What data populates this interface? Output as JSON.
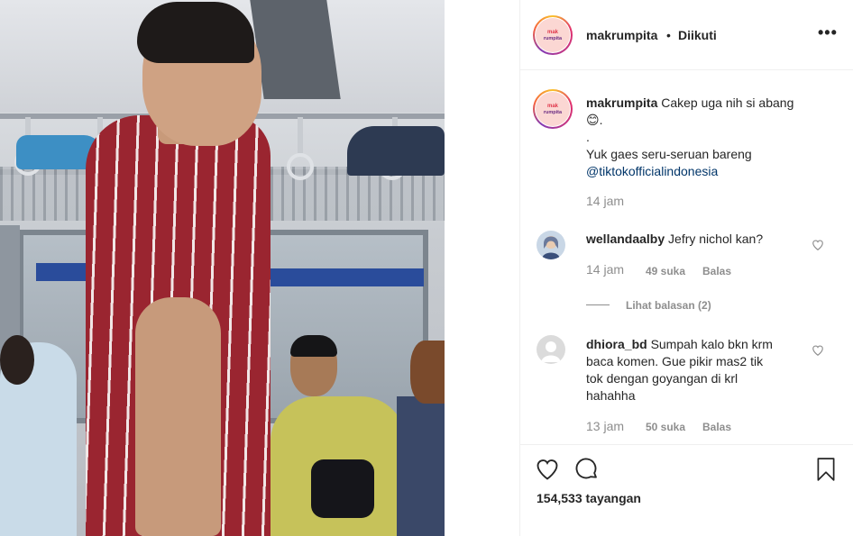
{
  "post": {
    "author": "makrumpita",
    "follow_state": "Diikuti",
    "separator": "•",
    "more_label": "•••",
    "avatar_logo_line1": "mak",
    "avatar_logo_line2": "rumpita"
  },
  "caption": {
    "username": "makrumpita",
    "line1": "Cakep uga nih si abang",
    "emoji": "😊",
    "line1_end": ".",
    "line2": ".",
    "line3": "Yuk gaes seru-seruan bareng",
    "mention": "@tiktokofficialindonesia",
    "time": "14 jam"
  },
  "comments": [
    {
      "username": "wellandaalby",
      "text": "Jefry nichol kan?",
      "time": "14 jam",
      "likes": "49 suka",
      "reply_label": "Balas",
      "view_replies": "Lihat balasan (2)"
    },
    {
      "username": "dhiora_bd",
      "text_lines": [
        "Sumpah kalo bkn krm",
        "baca komen. Gue pikir mas2 tik",
        "tok dengan goyangan di krl",
        "hahahha"
      ],
      "time": "13 jam",
      "likes": "50 suka",
      "reply_label": "Balas"
    }
  ],
  "stats": {
    "views": "154,533 tayangan"
  },
  "icons": {
    "like": "heart-icon",
    "comment": "comment-icon",
    "save": "bookmark-icon",
    "options": "more-options-icon"
  },
  "colors": {
    "link": "#003569",
    "muted": "#8e8e8e",
    "text": "#262626"
  }
}
